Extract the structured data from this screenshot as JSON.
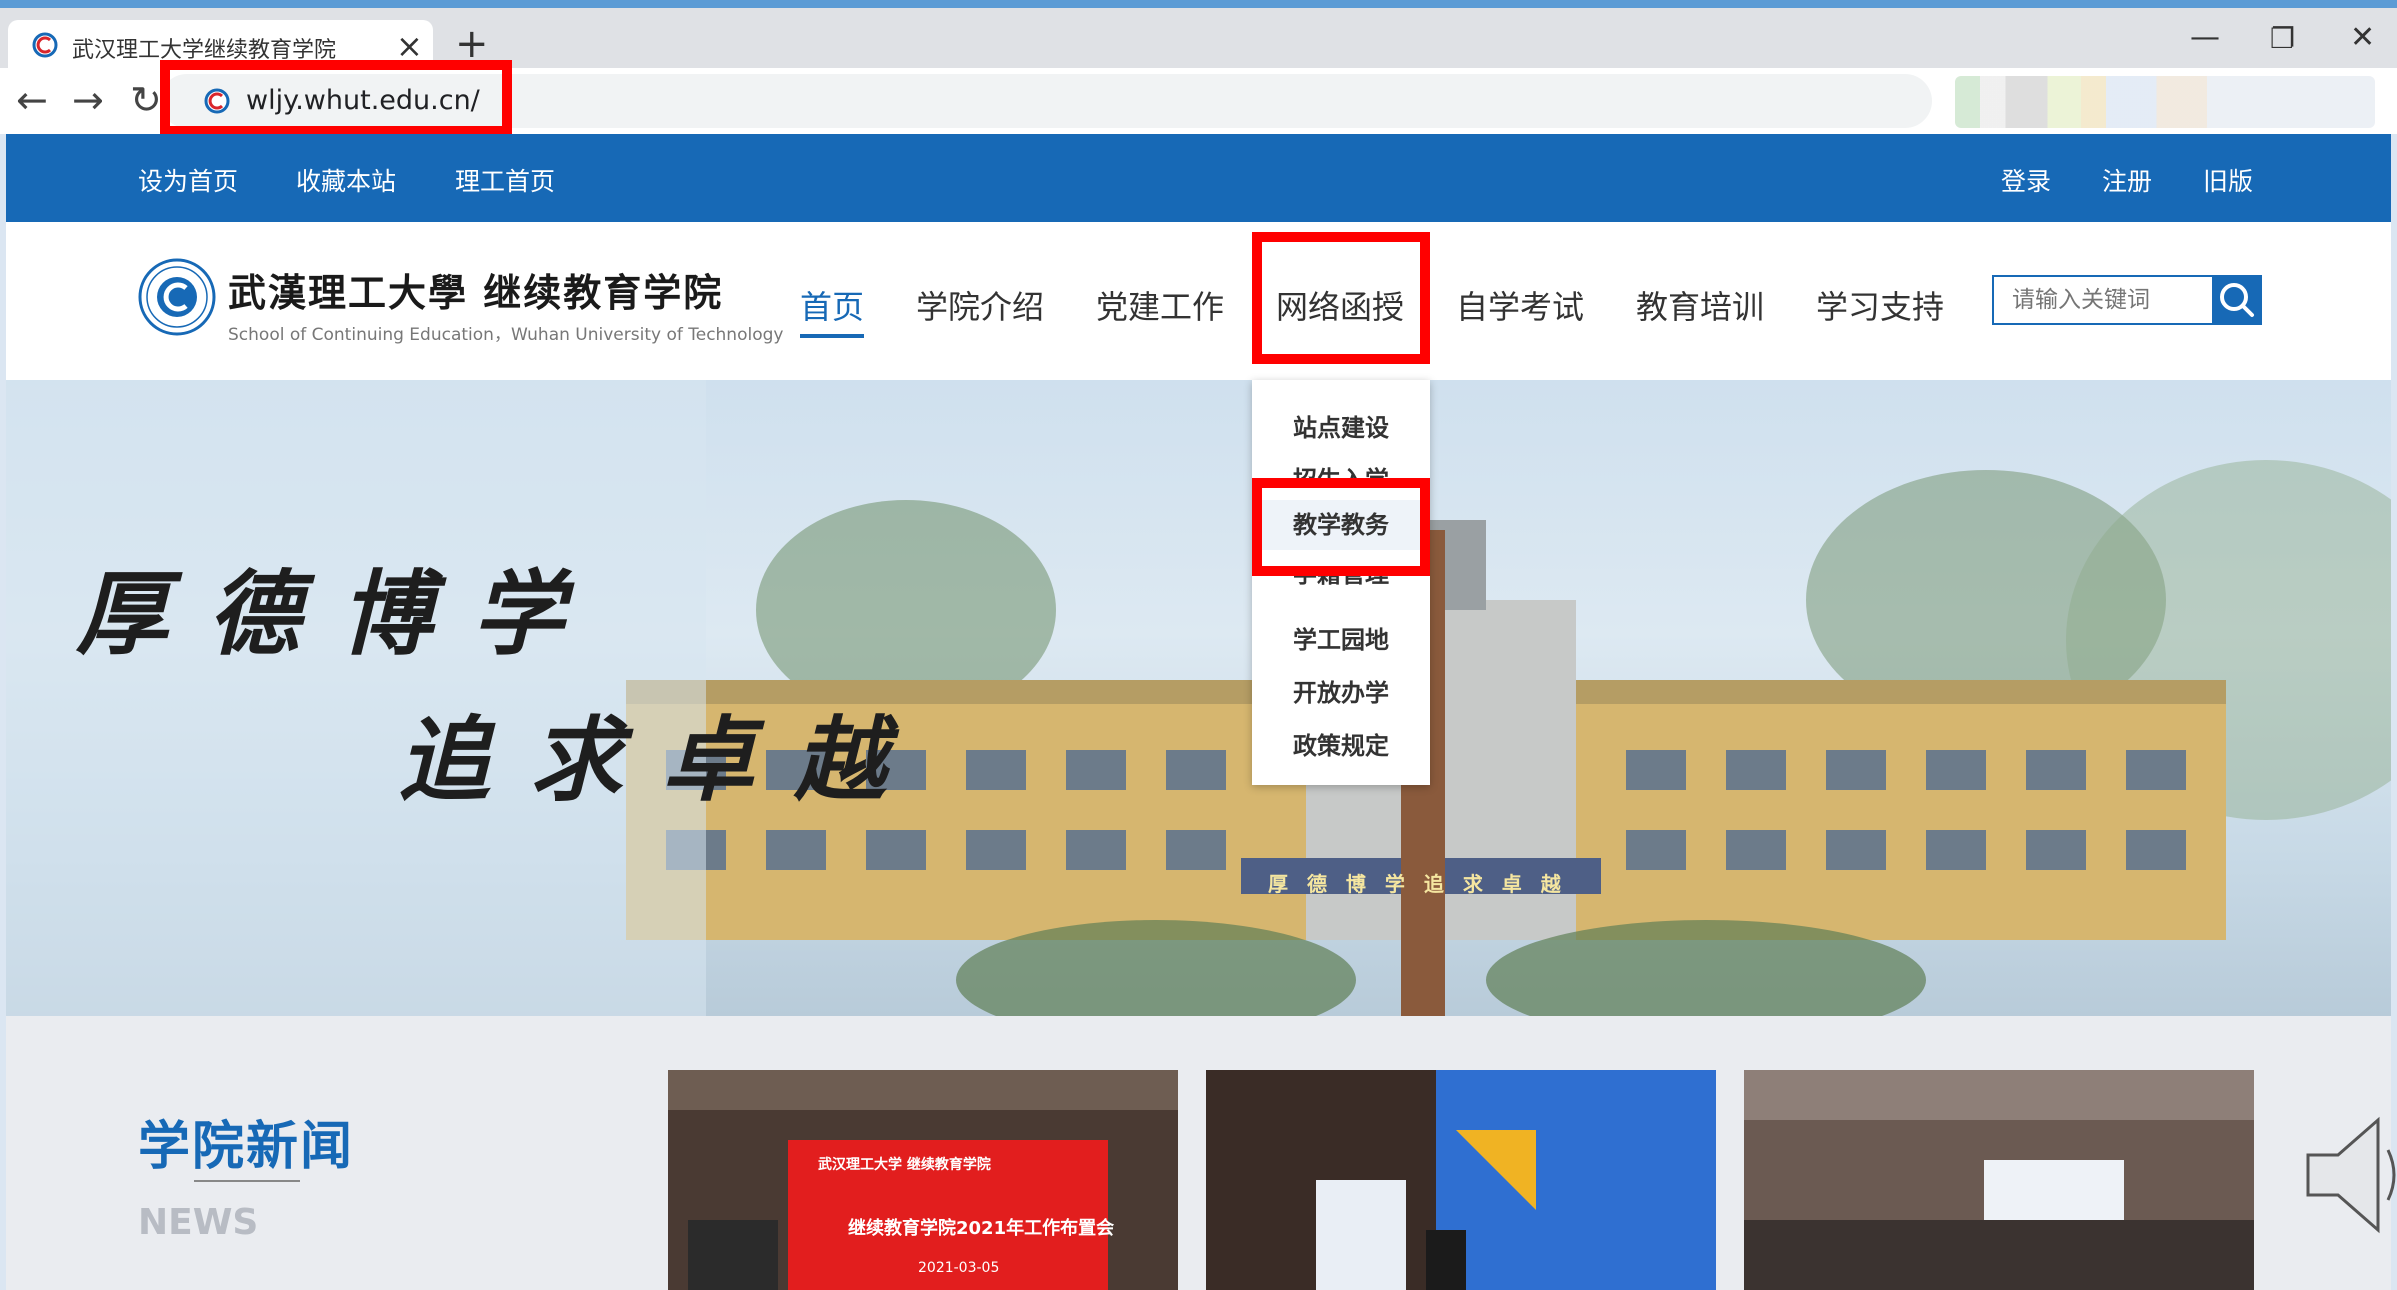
{
  "browser": {
    "tab_title": "武汉理工大学继续教育学院",
    "tab_close": "×",
    "new_tab": "+",
    "url": "wljy.whut.edu.cn/",
    "back_icon": "←",
    "forward_icon": "→",
    "reload_icon": "↻",
    "minimize": "—",
    "restore": "❐",
    "close": "✕"
  },
  "topbar": {
    "left_links": [
      "设为首页",
      "收藏本站",
      "理工首页"
    ],
    "right_links": [
      "登录",
      "注册",
      "旧版"
    ]
  },
  "header": {
    "logo_cn": "武漢理工大學 继续教育学院",
    "logo_en": "School of Continuing Education，Wuhan University of Technology",
    "nav": [
      "首页",
      "学院介绍",
      "党建工作",
      "网络函授",
      "自学考试",
      "教育培训",
      "学习支持"
    ],
    "active_nav": "首页",
    "search_placeholder": "请输入关键词"
  },
  "dropdown": {
    "parent": "网络函授",
    "items": [
      "站点建设",
      "招生入学",
      "教学教务",
      "学籍管理",
      "学工园地",
      "开放办学",
      "政策规定"
    ],
    "highlighted": "教学教务"
  },
  "banner": {
    "slogan_line1": "厚德博学",
    "slogan_line2": "追求卓越",
    "building_sign": "厚 德 博 学 追 求 卓 越"
  },
  "news": {
    "title": "学院新闻",
    "subtitle": "NEWS",
    "photo1_caption_top": "武汉理工大学 继续教育学院",
    "photo1_caption": "继续教育学院2021年工作布置会",
    "photo1_date": "2021-03-05"
  },
  "colors": {
    "brand_blue": "#1769b6",
    "highlight_red": "#ff0000"
  }
}
